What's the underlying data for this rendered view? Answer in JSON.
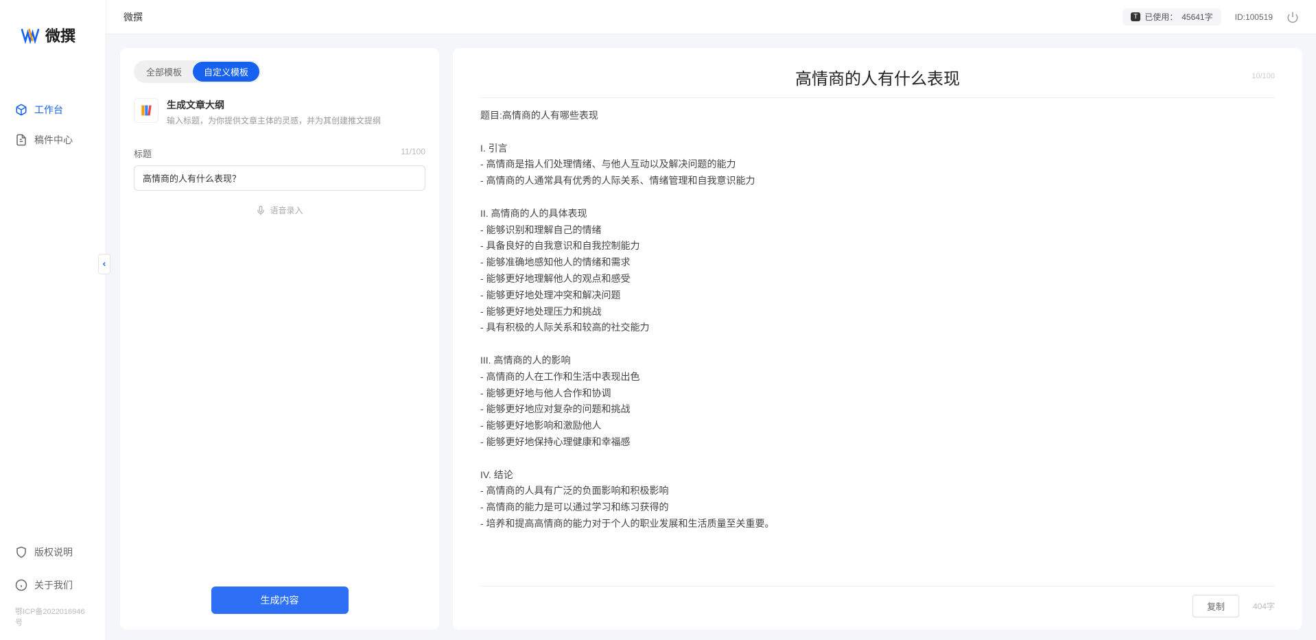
{
  "app": {
    "name": "微撰",
    "top_title": "微撰"
  },
  "sidebar": {
    "items": [
      {
        "label": "工作台"
      },
      {
        "label": "稿件中心"
      }
    ],
    "bottom": [
      {
        "label": "版权说明"
      },
      {
        "label": "关于我们"
      }
    ],
    "icp": "鄂ICP备2022016946号"
  },
  "header": {
    "usage_prefix": "已使用：",
    "usage_value": "45641字",
    "id_label": "ID:100519"
  },
  "left": {
    "tabs": [
      {
        "label": "全部模板"
      },
      {
        "label": "自定义模板"
      }
    ],
    "template": {
      "title": "生成文章大纲",
      "desc": "输入标题，为你提供文章主体的灵感，并为其创建推文提纲"
    },
    "field": {
      "label": "标题",
      "count": "11/100",
      "value": "高情商的人有什么表现？"
    },
    "voice": "语音录入",
    "generate": "生成内容"
  },
  "right": {
    "title": "高情商的人有什么表现",
    "title_count": "10/100",
    "body": "题目:高情商的人有哪些表现\n\nI. 引言\n- 高情商是指人们处理情绪、与他人互动以及解决问题的能力\n- 高情商的人通常具有优秀的人际关系、情绪管理和自我意识能力\n\nII. 高情商的人的具体表现\n- 能够识别和理解自己的情绪\n- 具备良好的自我意识和自我控制能力\n- 能够准确地感知他人的情绪和需求\n- 能够更好地理解他人的观点和感受\n- 能够更好地处理冲突和解决问题\n- 能够更好地处理压力和挑战\n- 具有积极的人际关系和较高的社交能力\n\nIII. 高情商的人的影响\n- 高情商的人在工作和生活中表现出色\n- 能够更好地与他人合作和协调\n- 能够更好地应对复杂的问题和挑战\n- 能够更好地影响和激励他人\n- 能够更好地保持心理健康和幸福感\n\nIV. 结论\n- 高情商的人具有广泛的负面影响和积极影响\n- 高情商的能力是可以通过学习和练习获得的\n- 培养和提高高情商的能力对于个人的职业发展和生活质量至关重要。",
    "copy": "复制",
    "word_count": "404字"
  }
}
